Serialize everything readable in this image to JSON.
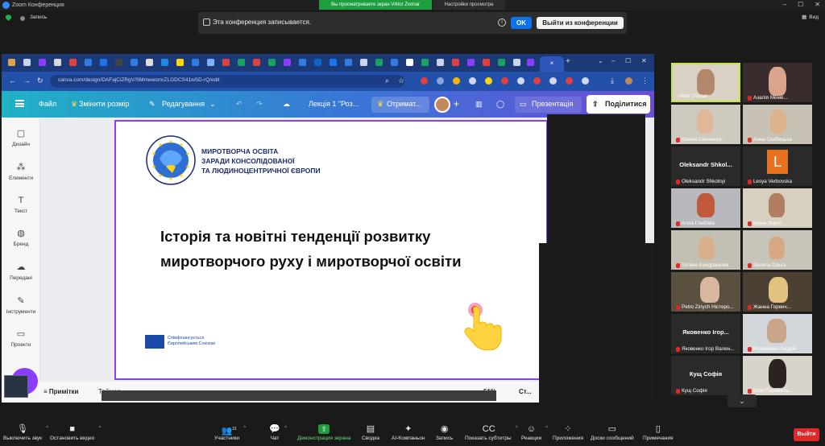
{
  "window": {
    "title": "Zoom Конференция",
    "share_banner": "Вы просматриваете экран Viktor Zvonar",
    "viewer_settings": "Настройки просмотра"
  },
  "top": {
    "record_label": "Запись",
    "view_label": "Вид"
  },
  "recording_bar": {
    "message": "Эта конференция записывается.",
    "ok": "OK",
    "leave": "Выйти из конференции"
  },
  "browser": {
    "url": "canva.com/design/DAFajCiZRgV/SMmewomrZLGDCS41wSD-rQ/edit",
    "active_tab": "×"
  },
  "canva": {
    "menu_file": "Файл",
    "resize": "Змінити розмір",
    "editing": "Редагування",
    "doc_title": "Лекція 1 \"Роз...",
    "get_pro": "Отримат...",
    "present": "Презентація",
    "share": "Поділитися",
    "sidebar": [
      "Дизайн",
      "Елементи",
      "Текст",
      "Бренд",
      "Передані",
      "Інструменти",
      "Проекти"
    ],
    "notes": "Примітки",
    "timer": "Таймер",
    "zoom_pct": "51%",
    "pages": "Ст..."
  },
  "slide": {
    "org_line1": "МИРОТВОРЧА ОСВІТА",
    "org_line2": "ЗАРАДИ КОНСОЛІДОВАНОЇ",
    "org_line3": "ТА ЛЮДИНОЦЕНТРИЧНОЇ ЄВРОПИ",
    "headline_line1": "Історія та новітні тенденції розвитку",
    "headline_line2": "миротворчого руху і миротворчої освіти",
    "eu_line1": "Співфінансується",
    "eu_line2": "Європейським Союзом"
  },
  "participants": [
    {
      "name": "Viktor Zvonar",
      "video": true
    },
    {
      "name": "Азалія Меме...",
      "video": true
    },
    {
      "name": "Олена Сенченко...",
      "video": true
    },
    {
      "name": "Анна Скабицька",
      "video": true
    },
    {
      "name": "Oleksandr Shkolnyi",
      "big": "Oleksandr Shkol..."
    },
    {
      "name": "Lesya Verbovska",
      "letter": "L"
    },
    {
      "name": "Алла Глебова",
      "video": true
    },
    {
      "name": "Ірина Зерке...",
      "video": true
    },
    {
      "name": "Тетяна Кондрашова",
      "video": true
    },
    {
      "name": "Зелепа Ольга",
      "video": true
    },
    {
      "name": "Petro Zinych Ністеро...",
      "video": true
    },
    {
      "name": "Жанна Горянч...",
      "video": true
    },
    {
      "name": "Яковенко Ігор Вален...",
      "big": "Яковенко Ігор..."
    },
    {
      "name": "Моховенко Андрій",
      "video": true
    },
    {
      "name": "Кущ Софія",
      "big": "Кущ Софія"
    },
    {
      "name": "Юля Переваль...",
      "video": true
    }
  ],
  "toolbar": {
    "mute": "Выключить звук",
    "video": "Остановить видео",
    "participants": "Участники",
    "participants_count": "31",
    "chat": "Чат",
    "share": "Демонстрация экрана",
    "summary": "Сводка",
    "ai": "AI-Компаньон",
    "record": "Запись",
    "subtitles": "Показать субтитры",
    "reactions": "Реакции",
    "apps": "Приложения",
    "whiteboards": "Доски сообщений",
    "notes": "Примечания",
    "exit": "Выйти"
  },
  "colors": {
    "zoom_blue": "#0e72ed",
    "canva_purple": "#8b3dff",
    "leave_red": "#e02828",
    "share_green": "#1e9e3e"
  }
}
